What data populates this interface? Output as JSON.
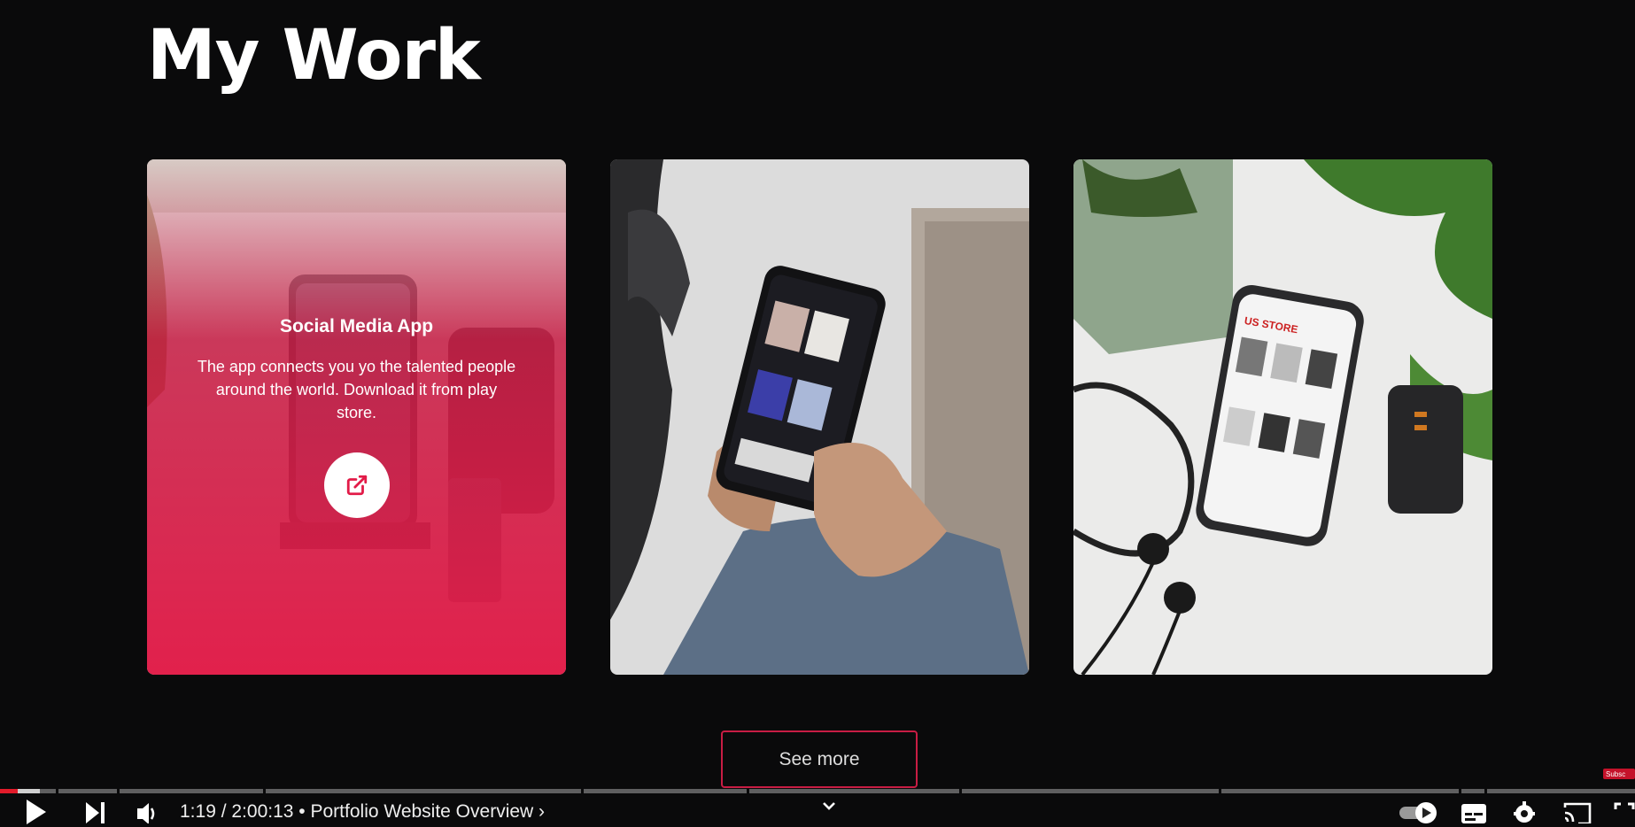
{
  "section": {
    "title": "My Work"
  },
  "cards": [
    {
      "title": "Social Media App",
      "description": "The app connects you yo the talented people around the world. Download it from play store.",
      "link_icon": "external-link-icon"
    },
    {
      "image": "phone-music-app-photo"
    },
    {
      "image": "phone-store-app-photo"
    }
  ],
  "see_more_label": "See more",
  "player": {
    "time": "1:19 / 2:00:13",
    "separator": "•",
    "chapter": "Portfolio Website Overview",
    "chapter_chevron": "›",
    "progress_fraction": 0.011,
    "icons": [
      "play-icon",
      "next-icon",
      "volume-icon",
      "chevron-down-icon",
      "autoplay-toggle-icon",
      "subtitles-icon",
      "settings-icon",
      "cast-icon",
      "fullscreen-icon"
    ],
    "subscribe_badge": "Subsc"
  },
  "colors": {
    "accent": "#e21b48",
    "background": "#0a0a0b",
    "progress_played": "#e21b2a"
  }
}
